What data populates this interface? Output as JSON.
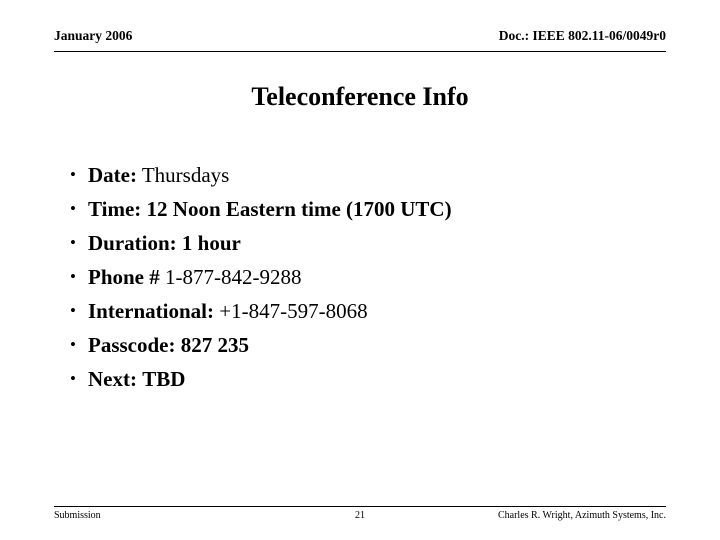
{
  "header": {
    "left": "January 2006",
    "right": "Doc.:  IEEE 802.11-06/0049r0"
  },
  "title": "Teleconference Info",
  "bullets": [
    {
      "marker": "•",
      "label": "Date:",
      "value": "Thursdays",
      "bold_value": false
    },
    {
      "marker": "•",
      "label": "Time:",
      "value": "12 Noon Eastern time (1700 UTC)",
      "bold_value": true
    },
    {
      "marker": "•",
      "label": "Duration:",
      "value": "1 hour",
      "bold_value": true
    },
    {
      "marker": "•",
      "label": "Phone #",
      "value": "1-877-842-9288",
      "bold_value": false
    },
    {
      "marker": "•",
      "label": "International:",
      "value": "+1-847-597-8068",
      "bold_value": false
    },
    {
      "marker": "•",
      "label": "Passcode:",
      "value": "827 235",
      "bold_value": true
    },
    {
      "marker": "•",
      "label": "Next:",
      "value": "TBD",
      "bold_value": true
    }
  ],
  "footer": {
    "left": "Submission",
    "page": "21",
    "right": "Charles R. Wright, Azimuth Systems, Inc."
  }
}
